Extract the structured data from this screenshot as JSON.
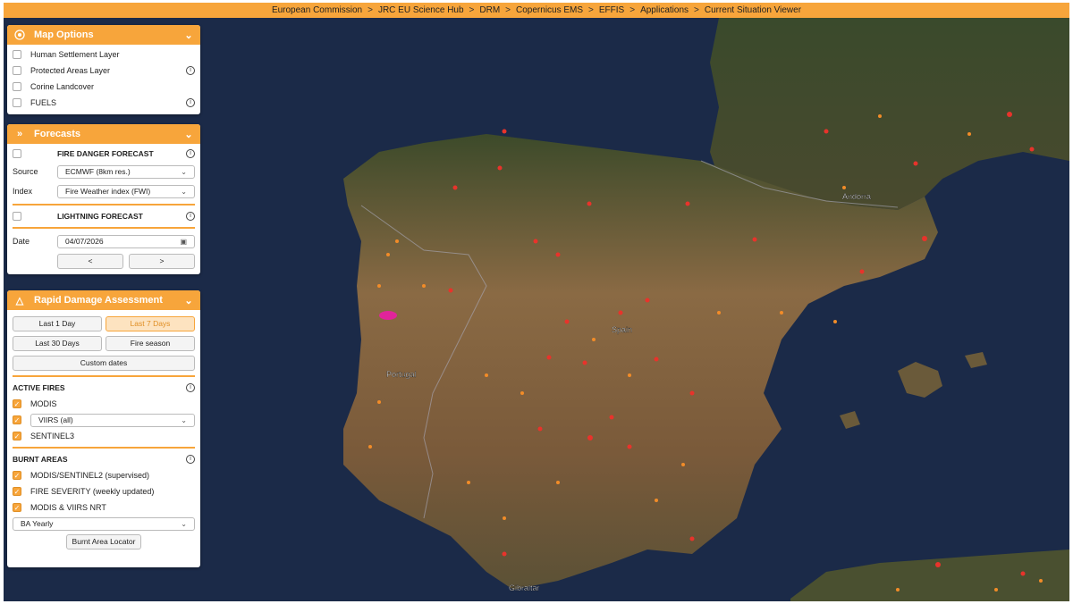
{
  "breadcrumb": [
    "European Commission",
    "JRC EU Science Hub",
    "DRM",
    "Copernicus EMS",
    "EFFIS",
    "Applications",
    "Current Situation Viewer"
  ],
  "breadcrumb_separator": ">",
  "map_options": {
    "title": "Map Options",
    "layers": [
      "Human Settlement Layer",
      "Protected Areas Layer",
      "Corine Landcover",
      "FUELS"
    ]
  },
  "forecasts": {
    "title": "Forecasts",
    "fire_danger_label": "FIRE DANGER FORECAST",
    "source_label": "Source",
    "source_value": "ECMWF (8km res.)",
    "index_label": "Index",
    "index_value": "Fire Weather index (FWI)",
    "lightning_label": "LIGHTNING FORECAST",
    "date_label": "Date",
    "date_value": "04/07/2026",
    "prev_label": "<",
    "next_label": ">"
  },
  "rapid": {
    "title": "Rapid Damage Assessment",
    "last1": "Last 1 Day",
    "last7": "Last 7 Days",
    "last30": "Last 30 Days",
    "season": "Fire season",
    "custom": "Custom dates",
    "active_fires": "ACTIVE FIRES",
    "modis": "MODIS",
    "viirs": "VIIRS (all)",
    "sentinel3": "SENTINEL3",
    "burnt_areas": "BURNT AREAS",
    "ms2": "MODIS/SENTINEL2 (supervised)",
    "severity": "FIRE SEVERITY (weekly updated)",
    "mv_nrt": "MODIS & VIIRS NRT",
    "ba_value": "BA Yearly",
    "locator": "Burnt Area Locator"
  },
  "map_labels": {
    "spain": "Spain",
    "portugal": "Portugal",
    "andorra": "Andorra",
    "gibraltar": "Gibraltar"
  },
  "colors": {
    "accent": "#f7a53b",
    "sea": "#1b2a48",
    "fire_red": "#e8332b",
    "fire_orange": "#f28c28",
    "burnt_magenta": "#e0249a"
  }
}
